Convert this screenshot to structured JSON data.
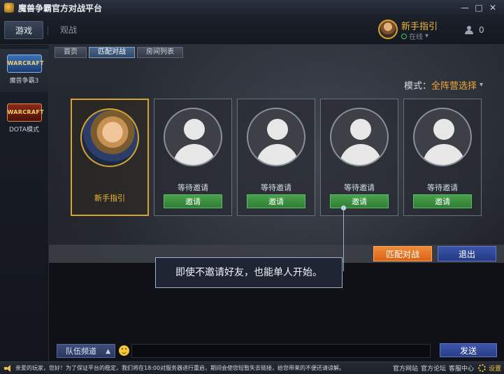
{
  "window": {
    "title": "魔兽争霸官方对战平台",
    "controls": [
      "—",
      "□",
      "✕"
    ]
  },
  "topnav": {
    "tabs": [
      {
        "label": "游戏",
        "active": true
      },
      {
        "label": "观战",
        "active": false
      }
    ],
    "user": {
      "name": "新手指引",
      "status": "在线"
    },
    "friends_count": "0"
  },
  "sidebar": {
    "items": [
      {
        "logo": "WARCRAFT",
        "label": "魔兽争霸3"
      },
      {
        "logo": "WARCRAFT",
        "label": "DOTA模式"
      }
    ]
  },
  "main": {
    "subtabs": [
      "首页",
      "匹配对战",
      "房间列表"
    ],
    "active_subtab": "匹配对战",
    "mode_label": "模式：",
    "mode_value": "全阵营选择",
    "slots": [
      {
        "type": "player",
        "name": "新手指引"
      },
      {
        "type": "empty",
        "status": "等待邀请",
        "button": "邀请"
      },
      {
        "type": "empty",
        "status": "等待邀请",
        "button": "邀请"
      },
      {
        "type": "empty",
        "status": "等待邀请",
        "button": "邀请"
      },
      {
        "type": "empty",
        "status": "等待邀请",
        "button": "邀请"
      }
    ],
    "match_button": "匹配对战",
    "exit_button": "退出",
    "tooltip": "即使不邀请好友，也能单人开始。"
  },
  "chat": {
    "channel": "队伍频道",
    "input_value": "",
    "send_button": "发送"
  },
  "statusbar": {
    "notice": "亲爱的玩家，您好！为了保证平台的稳定，我们将在18:00对服务器进行重启，期间会使您短暂失去链接，给您带来的不便还请谅解。",
    "links": [
      "官方网站",
      "官方论坛",
      "客服中心"
    ],
    "settings": "设置"
  },
  "colors": {
    "accent_gold": "#f1b63a",
    "invite_green": "#2f7f34",
    "match_orange": "#e8721f",
    "exit_blue": "#2b4596"
  }
}
